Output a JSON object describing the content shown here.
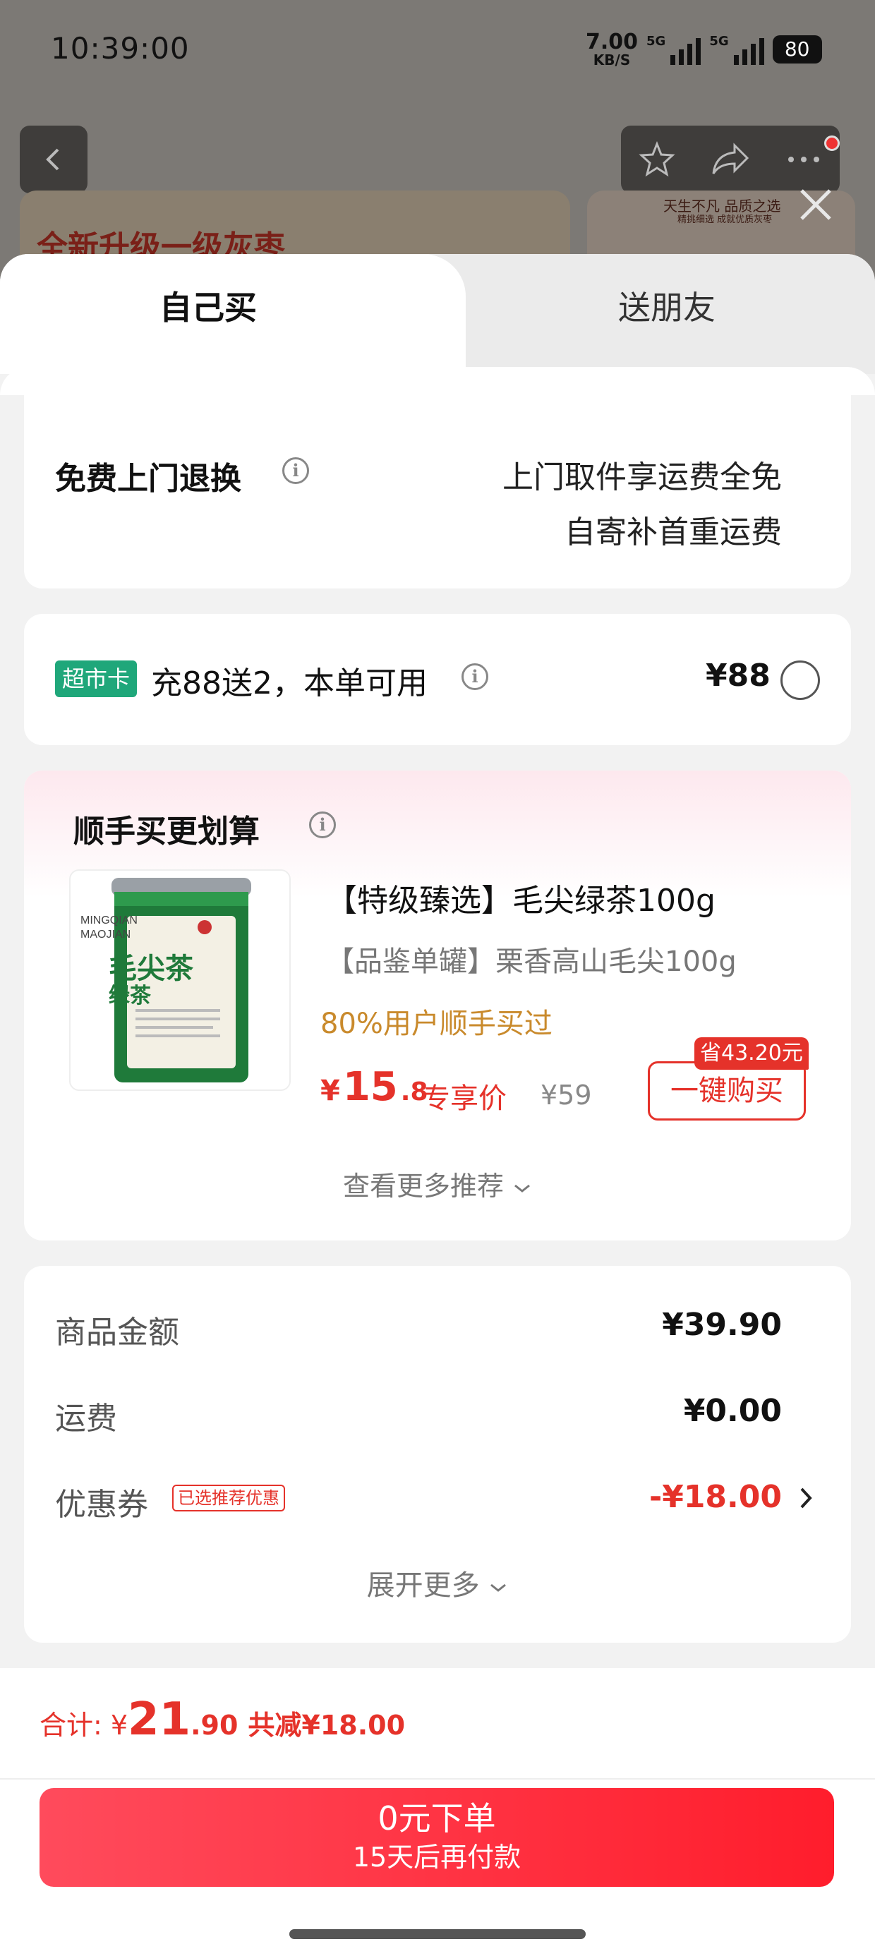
{
  "status_bar": {
    "time": "10:39:00",
    "net_speed_value": "7.00",
    "net_speed_unit": "KB/S",
    "signal1_label": "5G",
    "signal2_label": "5G",
    "battery": "80"
  },
  "background_page": {
    "banner_left_text": "全新升级一级灰枣",
    "banner_right_text": "天生不凡 品质之选",
    "banner_right_sub": "精挑细选 成就优质灰枣"
  },
  "tabs": {
    "self": "自己买",
    "friend": "送朋友"
  },
  "return_service": {
    "title": "免费上门退换",
    "line1": "上门取件享运费全免",
    "line2": "自寄补首重运费"
  },
  "member_card": {
    "badge": "超市卡",
    "text": "充88送2，本单可用",
    "price": "¥88"
  },
  "recommend": {
    "title": "顺手买更划算",
    "product_name": "【特级臻选】毛尖绿茶100g",
    "product_sub": "【品鉴单罐】栗香高山毛尖100g",
    "bought_text": "80%用户顺手买过",
    "price_currency": "¥",
    "price_int": "15",
    "price_dec": ".8",
    "price_tag": "专享价",
    "original_price": "¥59",
    "save_tag": "省43.20元",
    "buy_button": "一键购买",
    "more": "查看更多推荐",
    "can_text_cn": "毛尖茶",
    "can_text_cn2": "绿茶",
    "can_text_en1": "MINGQIAN",
    "can_text_en2": "MAOJIAN"
  },
  "summary": {
    "goods_label": "商品金额",
    "goods_value": "¥39.90",
    "shipping_label": "运费",
    "shipping_value": "¥0.00",
    "coupon_label": "优惠券",
    "coupon_tag": "已选推荐优惠",
    "coupon_value": "-¥18.00",
    "expand": "展开更多"
  },
  "footer": {
    "total_label": "合计:",
    "total_currency": "¥",
    "total_int": "21",
    "total_dec": ".90",
    "total_save": "共减¥18.00",
    "order_main": "0元下单",
    "order_sub": "15天后再付款"
  },
  "colors": {
    "accent_red": "#e5322a",
    "badge_green": "#1fa77a",
    "bought_orange": "#c98a2c"
  }
}
